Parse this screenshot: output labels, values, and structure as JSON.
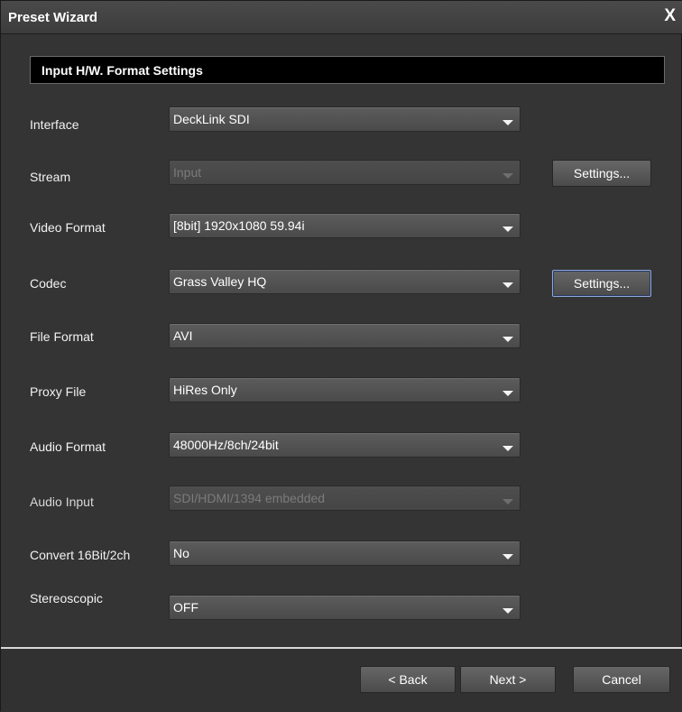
{
  "window": {
    "title": "Preset Wizard",
    "close_glyph": "X"
  },
  "section": {
    "title": "Input H/W. Format Settings"
  },
  "fields": {
    "interface": {
      "label": "Interface",
      "value": "DeckLink SDI"
    },
    "stream": {
      "label": "Stream",
      "value": "Input"
    },
    "video_format": {
      "label": "Video Format",
      "value": "[8bit] 1920x1080 59.94i"
    },
    "codec": {
      "label": "Codec",
      "value": "Grass Valley HQ"
    },
    "file_format": {
      "label": "File Format",
      "value": "AVI"
    },
    "proxy_file": {
      "label": "Proxy File",
      "value": "HiRes Only"
    },
    "audio_format": {
      "label": "Audio Format",
      "value": "48000Hz/8ch/24bit"
    },
    "audio_input": {
      "label": "Audio Input",
      "value": "SDI/HDMI/1394 embedded"
    },
    "convert": {
      "label": "Convert 16Bit/2ch",
      "value": "No"
    },
    "stereoscopic": {
      "label": "Stereoscopic",
      "value": "OFF"
    }
  },
  "buttons": {
    "stream_settings": "Settings...",
    "codec_settings": "Settings...",
    "back": "< Back",
    "next": "Next >",
    "cancel": "Cancel"
  },
  "icons": {
    "dropdown": "chevron-down-icon",
    "close": "close-icon"
  },
  "colors": {
    "background": "#343434",
    "header_bg": "#000000",
    "focus": "#8fa9d9"
  }
}
